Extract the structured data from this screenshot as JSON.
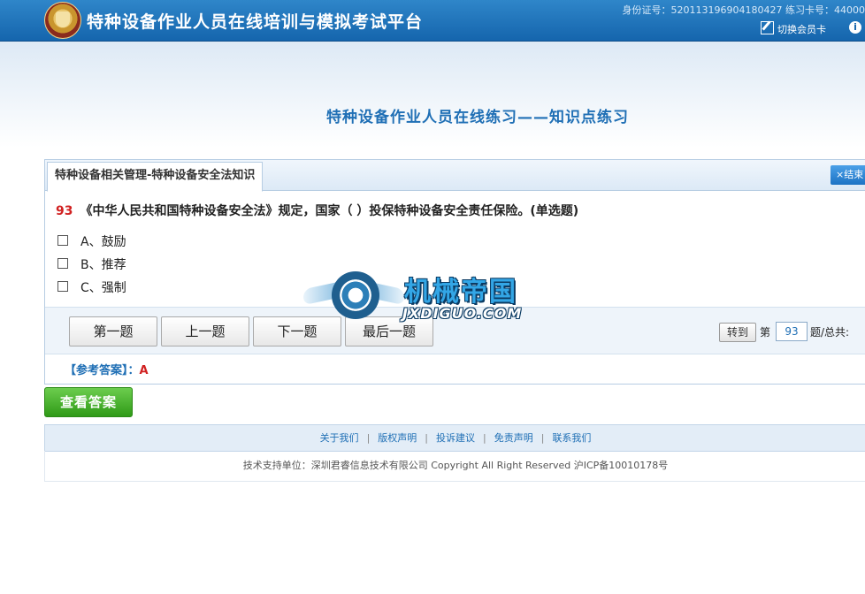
{
  "header": {
    "site_title": "特种设备作业人员在线培训与模拟考试平台",
    "id_info": "身份证号：520113196904180427   练习卡号：44000",
    "switch_card": "切换会员卡"
  },
  "page_heading": "特种设备作业人员在线练习——知识点练习",
  "tab": {
    "label": "特种设备相关管理-特种设备安全法知识"
  },
  "end_button": "×结束",
  "question": {
    "number": "93",
    "text": "《中华人民共和国特种设备安全法》规定，国家（ ）投保特种设备安全责任保险。(单选题)",
    "options": [
      "A、鼓励",
      "B、推荐",
      "C、强制"
    ]
  },
  "nav": {
    "first": "第一题",
    "prev": "上一题",
    "next": "下一题",
    "last": "最后一题",
    "goto_button": "转到",
    "goto_prefix": "第",
    "goto_value": "93",
    "goto_suffix": "题/总共:"
  },
  "answer": {
    "label": "【参考答案】：",
    "value": "A"
  },
  "check_answer_button": "查看答案",
  "footer": {
    "links": [
      "关于我们",
      "版权声明",
      "投诉建议",
      "免责声明",
      "联系我们"
    ],
    "separator": "|",
    "copyright": "技术支持单位：深圳君睿信息技术有限公司  Copyright  All Right Reserved  沪ICP备10010178号"
  },
  "watermark": {
    "cn": "机械帝国",
    "en": "JXDIGUO.COM"
  }
}
